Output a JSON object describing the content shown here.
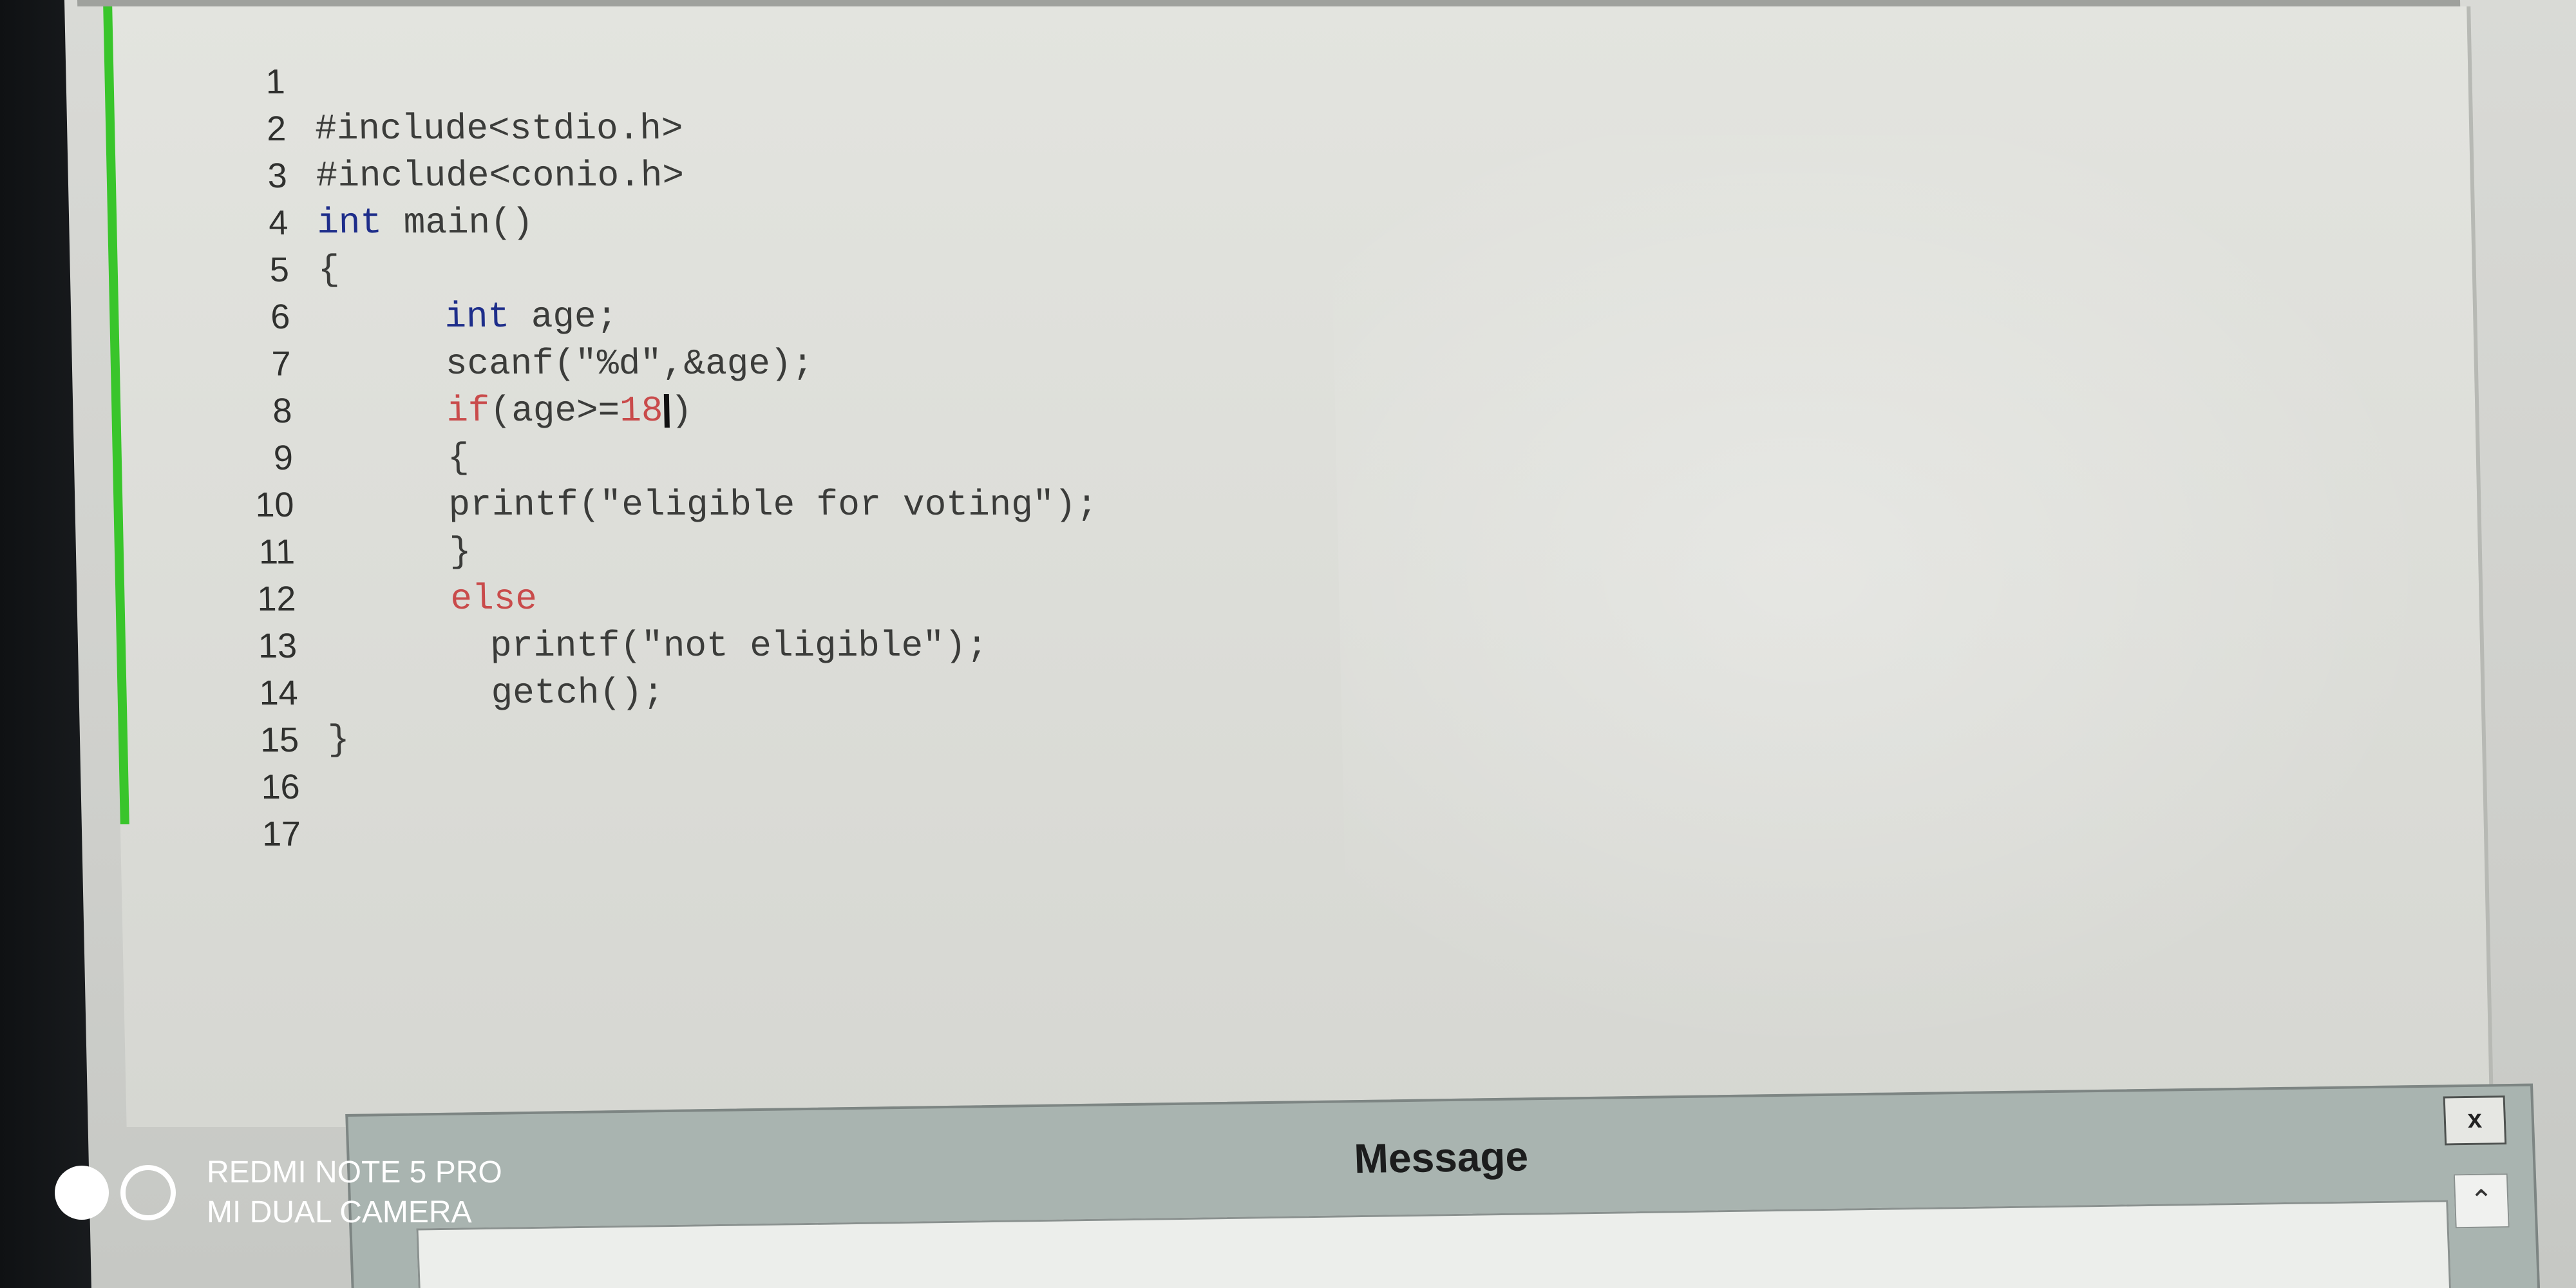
{
  "editor": {
    "lines": [
      {
        "num": "1",
        "text": "#include<stdio.h>"
      },
      {
        "num": "2",
        "text": "#include<conio.h>"
      },
      {
        "num": "3",
        "kw": "int",
        "text": " main()"
      },
      {
        "num": "4",
        "text": "{"
      },
      {
        "num": "5",
        "kw": "int",
        "text": " age;"
      },
      {
        "num": "6",
        "text": "scanf(\"%d\",&age);"
      },
      {
        "num": "7",
        "kw_red": "if",
        "text": "(age>=",
        "num_red": "18",
        "tail": ")"
      },
      {
        "num": "8",
        "text": "{"
      },
      {
        "num": "9",
        "text": "printf(\"eligible for voting\");"
      },
      {
        "num": "10",
        "text": "}"
      },
      {
        "num": "11",
        "kw_red": "else"
      },
      {
        "num": "12",
        "text": "printf(\"not eligible\");"
      },
      {
        "num": "13",
        "text": "getch();"
      },
      {
        "num": "14",
        "text": "}"
      },
      {
        "num": "15",
        "text": ""
      },
      {
        "num": "16",
        "text": ""
      },
      {
        "num": "17",
        "text": ""
      }
    ]
  },
  "dialog": {
    "title": "Message",
    "close_label": "x",
    "scroll_up_icon": "chevron-up-icon"
  },
  "watermark": {
    "line1": "REDMI NOTE 5 PRO",
    "line2": "MI DUAL CAMERA"
  },
  "colors": {
    "change_marker": "#39c52b",
    "keyword": "#1d2d8a",
    "red_keyword": "#c94b4b"
  }
}
